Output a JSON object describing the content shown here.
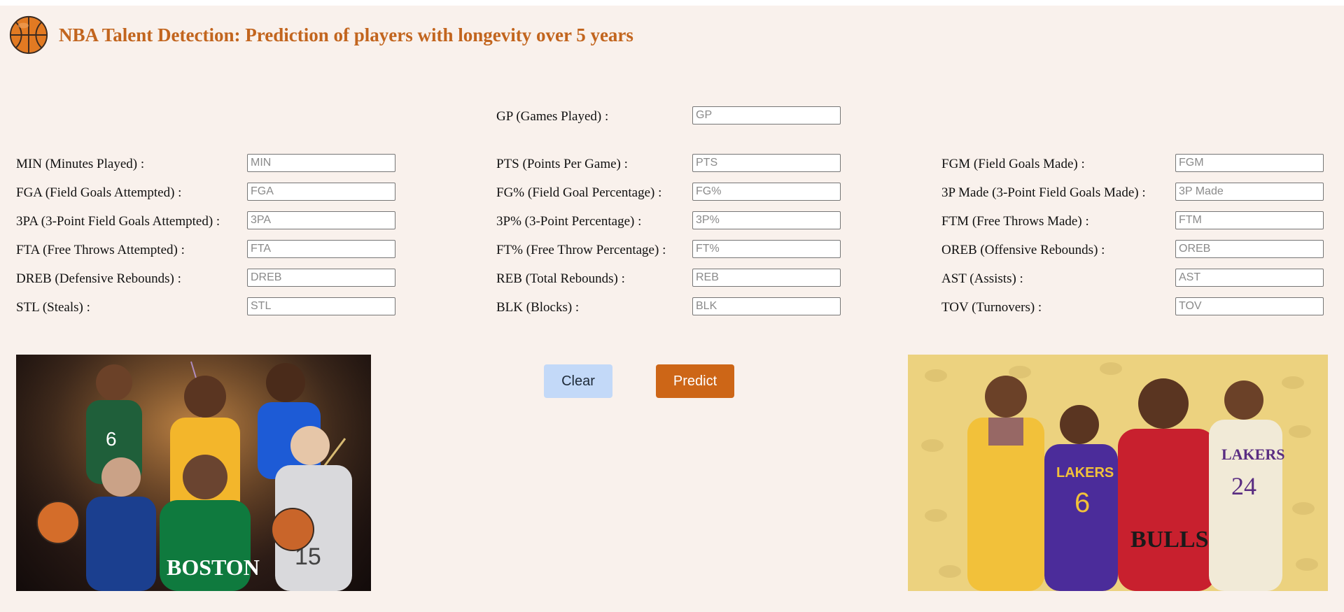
{
  "header": {
    "title": "NBA Talent Detection: Prediction of players with longevity over 5 years",
    "logo_icon": "basketball-icon"
  },
  "fields": [
    {
      "key": "gp",
      "label": "GP (Games Played) :",
      "placeholder": "GP",
      "value": ""
    },
    {
      "key": "min",
      "label": "MIN (Minutes Played) :",
      "placeholder": "MIN",
      "value": ""
    },
    {
      "key": "pts",
      "label": "PTS (Points Per Game) :",
      "placeholder": "PTS",
      "value": ""
    },
    {
      "key": "fgm",
      "label": "FGM (Field Goals Made) :",
      "placeholder": "FGM",
      "value": ""
    },
    {
      "key": "fga",
      "label": "FGA (Field Goals Attempted) :",
      "placeholder": "FGA",
      "value": ""
    },
    {
      "key": "fg_pct",
      "label": "FG% (Field Goal Percentage) :",
      "placeholder": "FG%",
      "value": ""
    },
    {
      "key": "three_made",
      "label": "3P Made (3-Point Field Goals Made) :",
      "placeholder": "3P Made",
      "value": ""
    },
    {
      "key": "three_pa",
      "label": "3PA (3-Point Field Goals Attempted) :",
      "placeholder": "3PA",
      "value": ""
    },
    {
      "key": "three_pct",
      "label": "3P% (3-Point Percentage) :",
      "placeholder": "3P%",
      "value": ""
    },
    {
      "key": "ftm",
      "label": "FTM (Free Throws Made) :",
      "placeholder": "FTM",
      "value": ""
    },
    {
      "key": "fta",
      "label": "FTA (Free Throws Attempted) :",
      "placeholder": "FTA",
      "value": ""
    },
    {
      "key": "ft_pct",
      "label": "FT% (Free Throw Percentage) :",
      "placeholder": "FT%",
      "value": ""
    },
    {
      "key": "oreb",
      "label": "OREB (Offensive Rebounds) :",
      "placeholder": "OREB",
      "value": ""
    },
    {
      "key": "dreb",
      "label": "DREB (Defensive Rebounds) :",
      "placeholder": "DREB",
      "value": ""
    },
    {
      "key": "reb",
      "label": "REB (Total Rebounds) :",
      "placeholder": "REB",
      "value": ""
    },
    {
      "key": "ast",
      "label": "AST (Assists) :",
      "placeholder": "AST",
      "value": ""
    },
    {
      "key": "stl",
      "label": "STL (Steals) :",
      "placeholder": "STL",
      "value": ""
    },
    {
      "key": "blk",
      "label": "BLK (Blocks) :",
      "placeholder": "BLK",
      "value": ""
    },
    {
      "key": "tov",
      "label": "TOV (Turnovers) :",
      "placeholder": "TOV",
      "value": ""
    }
  ],
  "buttons": {
    "clear_label": "Clear",
    "predict_label": "Predict"
  },
  "images": {
    "left": "nba-current-stars-collage",
    "right": "nba-legends-collage"
  },
  "colors": {
    "background": "#f9f1ec",
    "title": "#c2651e",
    "predict_button": "#cd6617",
    "clear_button": "#c3d9f8"
  }
}
